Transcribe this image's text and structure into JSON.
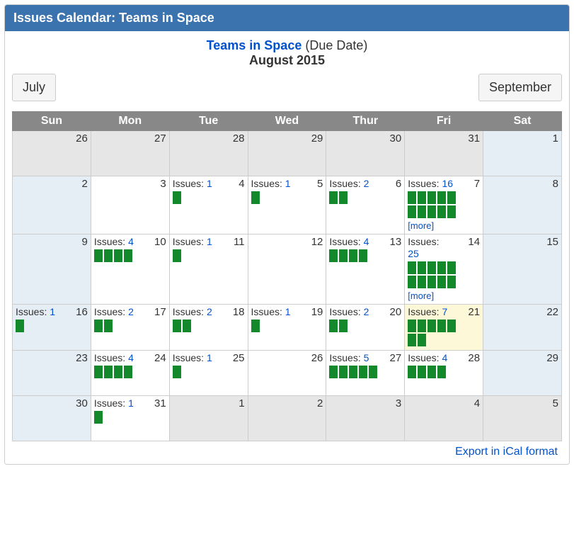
{
  "panel": {
    "title": "Issues Calendar: Teams in Space"
  },
  "header": {
    "project_link": "Teams in Space",
    "context": "(Due Date)",
    "month_title": "August 2015"
  },
  "nav": {
    "prev": "July",
    "next": "September"
  },
  "weekdays": [
    "Sun",
    "Mon",
    "Tue",
    "Wed",
    "Thur",
    "Fri",
    "Sat"
  ],
  "labels": {
    "issues": "Issues:",
    "more": "[more]"
  },
  "footer": {
    "export": "Export in iCal format"
  },
  "weeks": [
    [
      {
        "day": 26,
        "type": "other"
      },
      {
        "day": 27,
        "type": "other"
      },
      {
        "day": 28,
        "type": "other"
      },
      {
        "day": 29,
        "type": "other"
      },
      {
        "day": 30,
        "type": "other"
      },
      {
        "day": 31,
        "type": "other"
      },
      {
        "day": 1,
        "type": "weekend"
      }
    ],
    [
      {
        "day": 2,
        "type": "weekend"
      },
      {
        "day": 3,
        "type": "normal"
      },
      {
        "day": 4,
        "type": "normal",
        "issues": 1,
        "blocks": 1
      },
      {
        "day": 5,
        "type": "normal",
        "issues": 1,
        "blocks": 1
      },
      {
        "day": 6,
        "type": "normal",
        "issues": 2,
        "blocks": 2
      },
      {
        "day": 7,
        "type": "normal",
        "issues": 16,
        "blocks": 10,
        "more": true
      },
      {
        "day": 8,
        "type": "weekend"
      }
    ],
    [
      {
        "day": 9,
        "type": "weekend"
      },
      {
        "day": 10,
        "type": "normal",
        "issues": 4,
        "blocks": 4
      },
      {
        "day": 11,
        "type": "normal",
        "issues": 1,
        "blocks": 1
      },
      {
        "day": 12,
        "type": "normal"
      },
      {
        "day": 13,
        "type": "normal",
        "issues": 4,
        "blocks": 4
      },
      {
        "day": 14,
        "type": "normal",
        "issues": 25,
        "blocks": 10,
        "more": true,
        "count_below": true
      },
      {
        "day": 15,
        "type": "weekend"
      }
    ],
    [
      {
        "day": 16,
        "type": "weekend",
        "issues": 1,
        "blocks": 1
      },
      {
        "day": 17,
        "type": "normal",
        "issues": 2,
        "blocks": 2
      },
      {
        "day": 18,
        "type": "normal",
        "issues": 2,
        "blocks": 2
      },
      {
        "day": 19,
        "type": "normal",
        "issues": 1,
        "blocks": 1
      },
      {
        "day": 20,
        "type": "normal",
        "issues": 2,
        "blocks": 2
      },
      {
        "day": 21,
        "type": "today",
        "issues": 7,
        "blocks": 7
      },
      {
        "day": 22,
        "type": "weekend"
      }
    ],
    [
      {
        "day": 23,
        "type": "weekend"
      },
      {
        "day": 24,
        "type": "normal",
        "issues": 4,
        "blocks": 4
      },
      {
        "day": 25,
        "type": "normal",
        "issues": 1,
        "blocks": 1
      },
      {
        "day": 26,
        "type": "normal"
      },
      {
        "day": 27,
        "type": "normal",
        "issues": 5,
        "blocks": 5
      },
      {
        "day": 28,
        "type": "normal",
        "issues": 4,
        "blocks": 4
      },
      {
        "day": 29,
        "type": "weekend"
      }
    ],
    [
      {
        "day": 30,
        "type": "weekend"
      },
      {
        "day": 31,
        "type": "normal",
        "issues": 1,
        "blocks": 1
      },
      {
        "day": 1,
        "type": "other"
      },
      {
        "day": 2,
        "type": "other"
      },
      {
        "day": 3,
        "type": "other"
      },
      {
        "day": 4,
        "type": "other"
      },
      {
        "day": 5,
        "type": "other"
      }
    ]
  ]
}
